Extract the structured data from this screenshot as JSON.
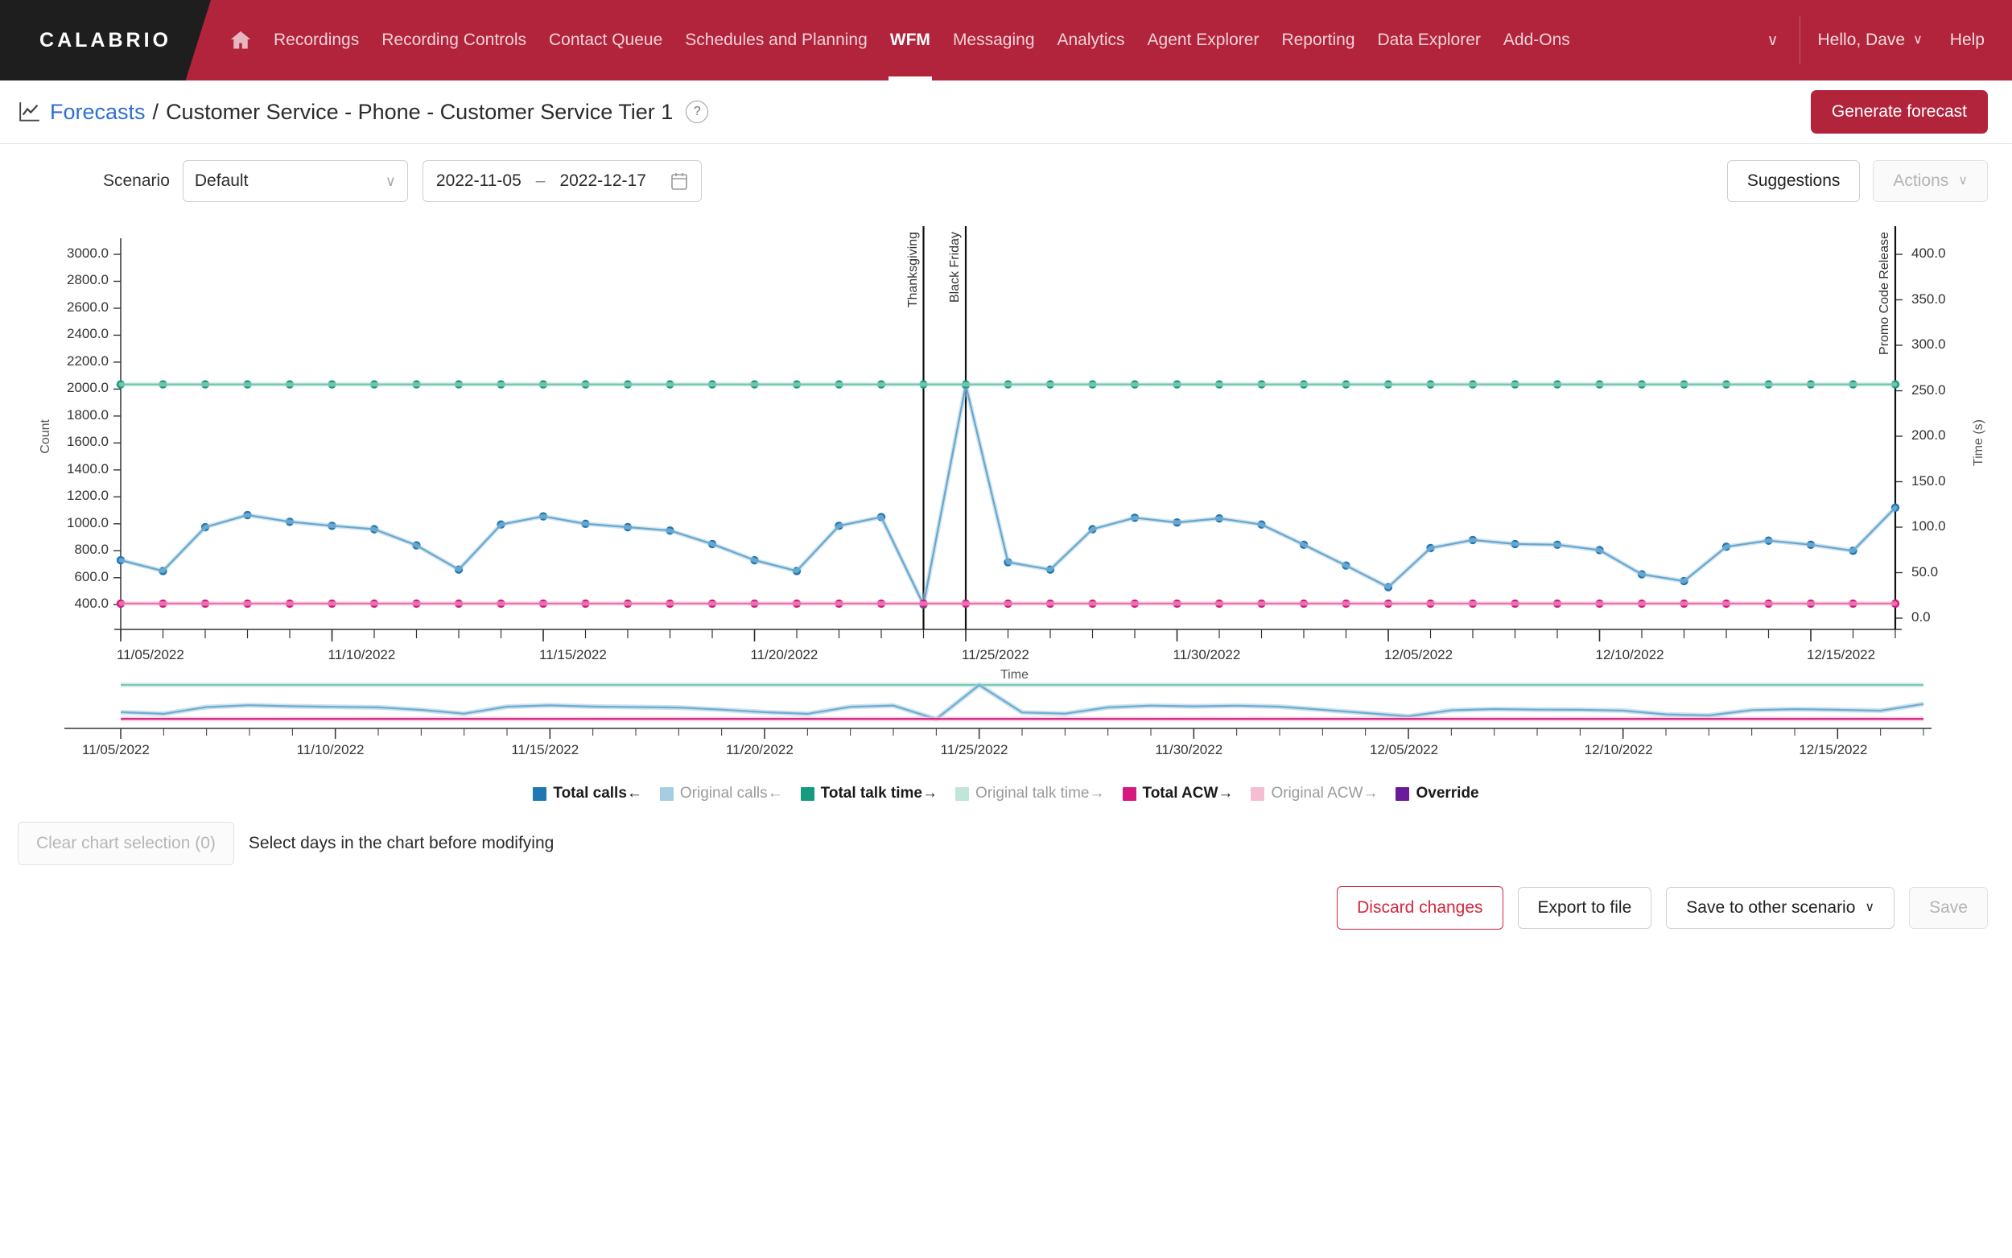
{
  "navbar": {
    "brand": "CALABRIO",
    "home_icon": "home-icon",
    "links": [
      {
        "label": "Recordings",
        "active": false
      },
      {
        "label": "Recording Controls",
        "active": false
      },
      {
        "label": "Contact Queue",
        "active": false
      },
      {
        "label": "Schedules and Planning",
        "active": false
      },
      {
        "label": "WFM",
        "active": true
      },
      {
        "label": "Messaging",
        "active": false
      },
      {
        "label": "Analytics",
        "active": false
      },
      {
        "label": "Agent Explorer",
        "active": false
      },
      {
        "label": "Reporting",
        "active": false
      },
      {
        "label": "Data Explorer",
        "active": false
      },
      {
        "label": "Add-Ons",
        "active": false
      }
    ],
    "overflow_caret": "∨",
    "user": "Hello, Dave",
    "user_caret": "∨",
    "help": "Help"
  },
  "header": {
    "breadcrumb_link": "Forecasts",
    "breadcrumb_sep": "/",
    "breadcrumb_title": "Customer Service - Phone - Customer Service Tier 1",
    "help_glyph": "?",
    "generate_label": "Generate forecast"
  },
  "toolbar": {
    "scenario_label": "Scenario",
    "scenario_value": "Default",
    "scenario_caret": "∨",
    "date_from": "2022-11-05",
    "date_dash": "–",
    "date_to": "2022-12-17",
    "suggestions_label": "Suggestions",
    "actions_label": "Actions",
    "actions_caret": "∨"
  },
  "footer": {
    "clear_selection_label": "Clear chart selection (0)",
    "selection_hint": "Select days in the chart before modifying",
    "discard_label": "Discard changes",
    "export_label": "Export to file",
    "save_other_label": "Save to other scenario",
    "save_other_caret": "∨",
    "save_label": "Save"
  },
  "colors": {
    "brand_red": "#b2243b",
    "total_calls": "#1f77b4",
    "original_calls": "#a6cee3",
    "total_talk_time": "#169b7f",
    "original_talk_time": "#bfe6d8",
    "total_acw": "#d6197f",
    "original_acw": "#f6bcd4",
    "override": "#6a1b9a",
    "link_blue": "#2f6fd0"
  },
  "chart_data": {
    "type": "line",
    "title": "",
    "xlabel": "Time",
    "ylabel": "Count",
    "y2label": "Time (s)",
    "grid": false,
    "legend_position": "bottom",
    "ylim": [
      300,
      3000
    ],
    "y2lim": [
      0,
      400
    ],
    "yticks": [
      "3000.0",
      "2800.0",
      "2600.0",
      "2400.0",
      "2200.0",
      "2000.0",
      "1800.0",
      "1600.0",
      "1400.0",
      "1200.0",
      "1000.0",
      "800.0",
      "600.0",
      "400.0"
    ],
    "y2ticks": [
      "400.0",
      "350.0",
      "300.0",
      "250.0",
      "200.0",
      "150.0",
      "100.0",
      "50.0",
      "0.0"
    ],
    "xticks": [
      "11/05/2022",
      "11/10/2022",
      "11/15/2022",
      "11/20/2022",
      "11/25/2022",
      "11/30/2022",
      "12/05/2022",
      "12/10/2022",
      "12/15/2022"
    ],
    "x_start": "2022-11-05",
    "x_end": "2022-12-17",
    "x": [
      "11/05/2022",
      "11/06/2022",
      "11/07/2022",
      "11/08/2022",
      "11/09/2022",
      "11/10/2022",
      "11/11/2022",
      "11/12/2022",
      "11/13/2022",
      "11/14/2022",
      "11/15/2022",
      "11/16/2022",
      "11/17/2022",
      "11/18/2022",
      "11/19/2022",
      "11/20/2022",
      "11/21/2022",
      "11/22/2022",
      "11/23/2022",
      "11/24/2022",
      "11/25/2022",
      "11/26/2022",
      "11/27/2022",
      "11/28/2022",
      "11/29/2022",
      "11/30/2022",
      "12/01/2022",
      "12/02/2022",
      "12/03/2022",
      "12/04/2022",
      "12/05/2022",
      "12/06/2022",
      "12/07/2022",
      "12/08/2022",
      "12/09/2022",
      "12/10/2022",
      "12/11/2022",
      "12/12/2022",
      "12/13/2022",
      "12/14/2022",
      "12/15/2022",
      "12/16/2022",
      "12/17/2022"
    ],
    "series": [
      {
        "name": "Total calls←",
        "axis": "left",
        "color": "#1f77b4",
        "markers": true,
        "values": [
          730,
          650,
          975,
          1065,
          1015,
          985,
          960,
          840,
          660,
          995,
          1055,
          1000,
          975,
          950,
          850,
          730,
          650,
          985,
          1050,
          400,
          2030,
          715,
          660,
          960,
          1045,
          1010,
          1040,
          995,
          845,
          690,
          530,
          820,
          880,
          850,
          845,
          805,
          625,
          575,
          830,
          875,
          845,
          800,
          1120
        ]
      },
      {
        "name": "Original calls←",
        "axis": "left",
        "color": "#a6cee3",
        "markers": false,
        "values": [
          730,
          650,
          975,
          1065,
          1015,
          985,
          960,
          840,
          660,
          995,
          1055,
          1000,
          975,
          950,
          850,
          730,
          650,
          985,
          1050,
          400,
          2030,
          715,
          660,
          960,
          1045,
          1010,
          1040,
          995,
          845,
          690,
          530,
          820,
          880,
          850,
          845,
          805,
          625,
          575,
          830,
          875,
          845,
          800,
          1120
        ]
      },
      {
        "name": "Total talk time→",
        "axis": "right",
        "color": "#169b7f",
        "markers": true,
        "values": [
          257,
          257,
          257,
          257,
          257,
          257,
          257,
          257,
          257,
          257,
          257,
          257,
          257,
          257,
          257,
          257,
          257,
          257,
          257,
          257,
          257,
          257,
          257,
          257,
          257,
          257,
          257,
          257,
          257,
          257,
          257,
          257,
          257,
          257,
          257,
          257,
          257,
          257,
          257,
          257,
          257,
          257,
          257
        ]
      },
      {
        "name": "Original talk time→",
        "axis": "right",
        "color": "#bfe6d8",
        "markers": false,
        "values": [
          257,
          257,
          257,
          257,
          257,
          257,
          257,
          257,
          257,
          257,
          257,
          257,
          257,
          257,
          257,
          257,
          257,
          257,
          257,
          257,
          257,
          257,
          257,
          257,
          257,
          257,
          257,
          257,
          257,
          257,
          257,
          257,
          257,
          257,
          257,
          257,
          257,
          257,
          257,
          257,
          257,
          257,
          257
        ]
      },
      {
        "name": "Total ACW→",
        "axis": "right",
        "color": "#d6197f",
        "markers": true,
        "values": [
          16,
          16,
          16,
          16,
          16,
          16,
          16,
          16,
          16,
          16,
          16,
          16,
          16,
          16,
          16,
          16,
          16,
          16,
          16,
          16,
          16,
          16,
          16,
          16,
          16,
          16,
          16,
          16,
          16,
          16,
          16,
          16,
          16,
          16,
          16,
          16,
          16,
          16,
          16,
          16,
          16,
          16,
          16
        ]
      },
      {
        "name": "Original ACW→",
        "axis": "right",
        "color": "#f6bcd4",
        "markers": false,
        "values": [
          16,
          16,
          16,
          16,
          16,
          16,
          16,
          16,
          16,
          16,
          16,
          16,
          16,
          16,
          16,
          16,
          16,
          16,
          16,
          16,
          16,
          16,
          16,
          16,
          16,
          16,
          16,
          16,
          16,
          16,
          16,
          16,
          16,
          16,
          16,
          16,
          16,
          16,
          16,
          16,
          16,
          16,
          16
        ]
      },
      {
        "name": "Override",
        "axis": "left",
        "color": "#6a1b9a",
        "markers": false,
        "values": []
      }
    ],
    "annotations": [
      {
        "label": "Thanksgiving",
        "x": "11/24/2022"
      },
      {
        "label": "Black Friday",
        "x": "11/25/2022"
      },
      {
        "label": "Promo Code Release",
        "x": "12/17/2022"
      }
    ],
    "overview": {
      "xticks": [
        "11/05/2022",
        "11/10/2022",
        "11/15/2022",
        "11/20/2022",
        "11/25/2022",
        "11/30/2022",
        "12/05/2022",
        "12/10/2022",
        "12/15/2022"
      ]
    }
  }
}
